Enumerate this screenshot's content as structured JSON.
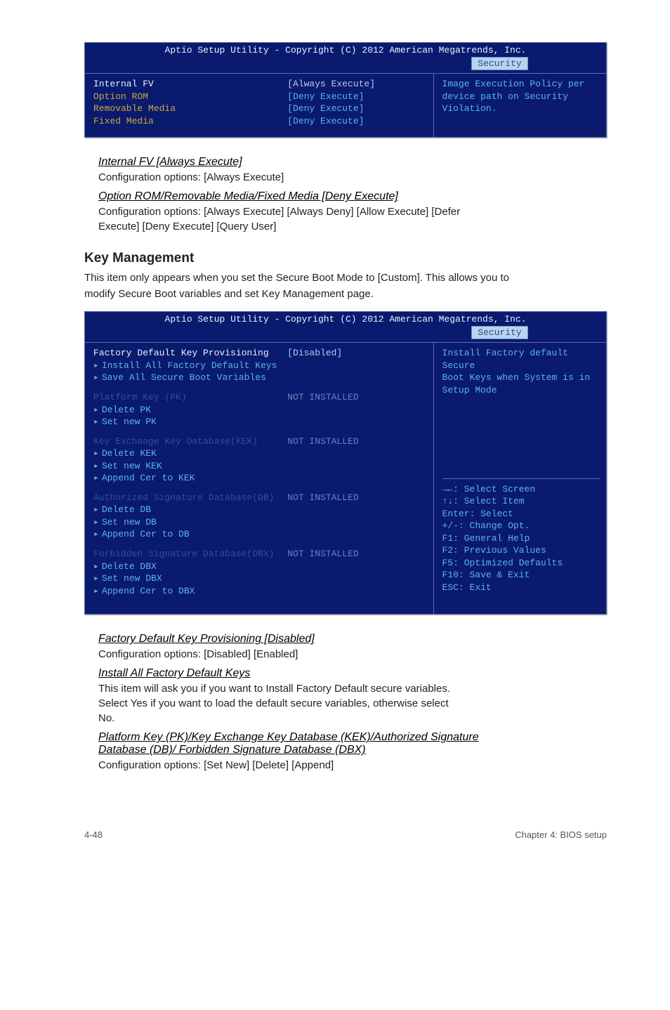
{
  "bios1": {
    "header": "Aptio Setup Utility - Copyright (C) 2012 American Megatrends, Inc.",
    "tab": "Security",
    "rows": [
      {
        "label": "Internal FV",
        "val": "[Always Execute]",
        "sel": true
      },
      {
        "label": "Option ROM",
        "val": "[Deny Execute]"
      },
      {
        "label": "Removable Media",
        "val": "[Deny Execute]"
      },
      {
        "label": "Fixed Media",
        "val": "[Deny Execute]"
      }
    ],
    "help1": "Image Execution Policy per",
    "help2": "device path on Security",
    "help3": "Violation."
  },
  "item_internal_fv": {
    "title": "Internal FV [Always Execute]",
    "text": "Configuration options: [Always Execute]"
  },
  "item_option_rom": {
    "title": "Option ROM/Removable Media/Fixed Media [Deny Execute]",
    "text1": "Configuration options: [Always Execute] [Always Deny] [Allow Execute] [Defer",
    "text2": "Execute] [Deny Execute] [Query User]"
  },
  "key_mgmt": {
    "heading": "Key Management",
    "intro1": "This item only appears when you set the Secure Boot Mode to [Custom]. This allows you to",
    "intro2": "modify Secure Boot variables and set Key Management page."
  },
  "bios2": {
    "header": "Aptio Setup Utility - Copyright (C) 2012 American Megatrends, Inc.",
    "tab": "Security",
    "row_factory": {
      "label": "Factory Default Key Provisioning",
      "val": "[Disabled]"
    },
    "row_install": {
      "label": "Install All Factory Default Keys"
    },
    "row_save": {
      "label": "Save   All Secure Boot Variables"
    },
    "row_pk": {
      "label": "Platform Key (PK)",
      "val": "NOT INSTALLED"
    },
    "row_pk_del": {
      "label": "Delete PK"
    },
    "row_pk_set": {
      "label": "Set new PK"
    },
    "row_kek": {
      "label": "Key Exchange Key Database(KEK)",
      "val": "NOT INSTALLED"
    },
    "row_kek_del": {
      "label": "Delete  KEK"
    },
    "row_kek_set": {
      "label": "Set new KEK"
    },
    "row_kek_app": {
      "label": "Append Cer to KEK"
    },
    "row_db": {
      "label": "Authorized Signature Database(DB)",
      "val": "NOT INSTALLED"
    },
    "row_db_del": {
      "label": "Delete  DB"
    },
    "row_db_set": {
      "label": "Set new DB"
    },
    "row_db_app": {
      "label": "Append Cer to DB"
    },
    "row_dbx": {
      "label": "Forbidden Signature Database(DBX)",
      "val": "NOT INSTALLED"
    },
    "row_dbx_del": {
      "label": "Delete  DBX"
    },
    "row_dbx_set": {
      "label": "Set new DBX"
    },
    "row_dbx_app": {
      "label": "Append Cer to DBX"
    },
    "help_top1": "Install Factory default Secure",
    "help_top2": "Boot Keys when System is in",
    "help_top3": "Setup Mode",
    "help_nav": {
      "l1": "→←: Select Screen",
      "l2": "↑↓: Select Item",
      "l3": "Enter: Select",
      "l4": "+/-: Change Opt.",
      "l5": "F1: General Help",
      "l6": "F2: Previous Values",
      "l7": "F5: Optimized Defaults",
      "l8": "F10: Save & Exit",
      "l9": "ESC: Exit"
    }
  },
  "item_factory": {
    "title": "Factory Default Key Provisioning [Disabled]",
    "text": "Configuration options: [Disabled] [Enabled]"
  },
  "item_install": {
    "title": "Install All Factory Default Keys",
    "text1": "This item will ask you if you want to Install Factory Default secure variables.",
    "text2": "Select Yes if you want to load the default secure variables, otherwise select",
    "text3": "No."
  },
  "item_db": {
    "title1": "Platform Key (PK)/Key Exchange Key Database (KEK)/Authorized Signature",
    "title2": "Database (DB)/ Forbidden Signature Database (DBX)",
    "text": "Configuration options: [Set New] [Delete] [Append]"
  },
  "footer": {
    "left": "4-48",
    "right": "Chapter 4: BIOS setup"
  }
}
